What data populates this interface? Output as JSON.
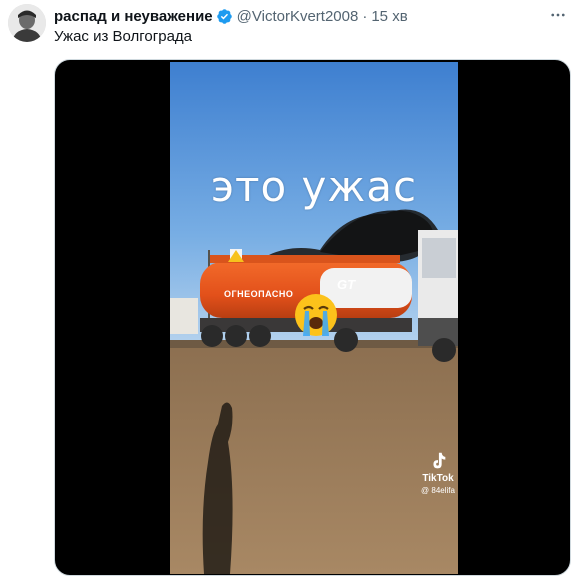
{
  "tweet": {
    "display_name": "распад и неуважение",
    "handle": "@VictorKvert2008",
    "separator": "·",
    "time": "15 хв",
    "text": "Ужас из Волгограда",
    "verified": true
  },
  "media": {
    "overlay_caption": "это ужас",
    "tanker_warning": "ОГНЕОПАСНО",
    "tanker_logo": "GT",
    "emoji": "loudly-crying-face",
    "watermark": {
      "label": "TikTok",
      "user": "@ 84elifa"
    }
  },
  "colors": {
    "accent": "#1d9bf0",
    "text": "#0f1419",
    "secondary": "#536471",
    "media_bg": "#000000",
    "tanker_orange": "#e8541c",
    "sky": "#4a8ed8"
  },
  "icons": {
    "verified": "verified-badge-icon",
    "more": "more-options-icon",
    "tiktok": "tiktok-logo-icon"
  }
}
